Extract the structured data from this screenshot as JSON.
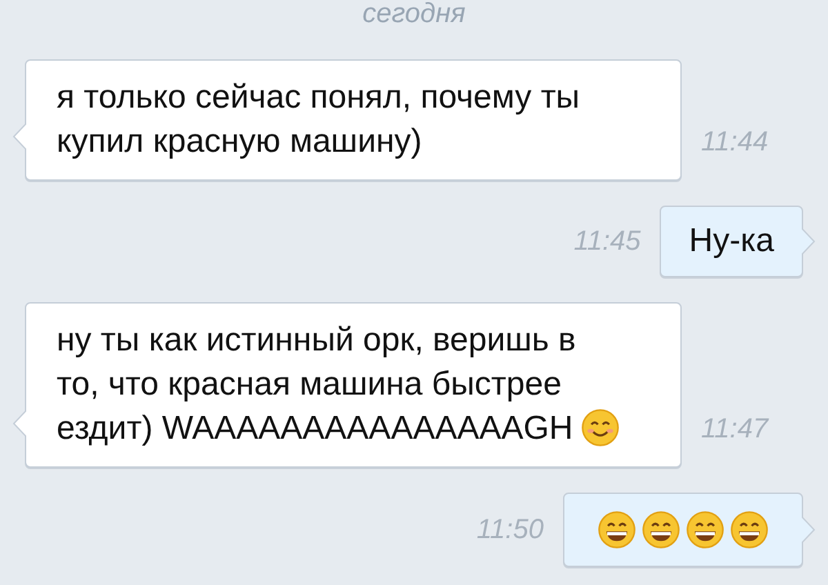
{
  "date_divider": "сегодня",
  "messages": [
    {
      "kind": "incoming",
      "text": "я только сейчас понял, почему ты купил красную машину)",
      "time": "11:44"
    },
    {
      "kind": "outgoing",
      "text": "Ну-ка",
      "time": "11:45"
    },
    {
      "kind": "incoming",
      "text": "ну ты как истинный орк, веришь в то, что красная машина быстрее ездит) WAAAAAAAAAAAAAAAGH",
      "emoji": [
        {
          "kind": "smiling"
        }
      ],
      "time": "11:47"
    },
    {
      "kind": "outgoing",
      "emoji": [
        {
          "kind": "grinning"
        },
        {
          "kind": "grinning"
        },
        {
          "kind": "grinning"
        },
        {
          "kind": "grinning"
        }
      ],
      "time": "11:50"
    }
  ]
}
